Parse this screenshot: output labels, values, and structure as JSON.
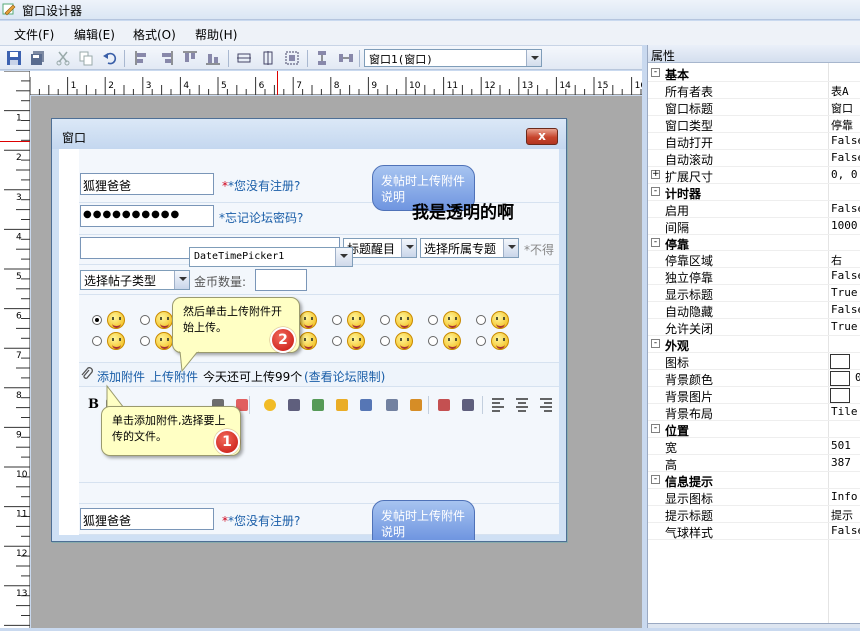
{
  "window": {
    "title": "窗口设计器"
  },
  "menu": [
    "文件(F)",
    "编辑(E)",
    "格式(O)",
    "帮助(H)"
  ],
  "toolbar": {
    "form_selector": "窗口1(窗口)"
  },
  "ruler": {
    "h_labels": [
      "1",
      "2",
      "3",
      "4",
      "5",
      "6",
      "7",
      "8",
      "9",
      "10",
      "11",
      "12",
      "13",
      "14",
      "15",
      "16"
    ],
    "v_labels": [
      "1",
      "2",
      "3",
      "4",
      "5",
      "6",
      "7",
      "8",
      "9",
      "10",
      "11",
      "12",
      "13"
    ]
  },
  "design_window": {
    "title": "窗口",
    "close_label": "x",
    "username_value": "狐狸爸爸",
    "not_registered": "*您没有注册?",
    "password_dots": "●●●●●●●●●●",
    "forgot_password": "*忘记论坛密码?",
    "bubble_text": "发帖时上传附件说明",
    "transparent_text": "我是透明的啊",
    "title_select": "标题醒目",
    "topic_select": "选择所属专题",
    "not_allowed": "*不得",
    "datetime_picker": "DateTimePicker1",
    "post_type": "选择帖子类型",
    "coin_label": "金币数量:",
    "attach_add": "添加附件",
    "attach_upload": "上传附件",
    "attach_info": "今天还可上传99个",
    "attach_limit": "(查看论坛限制)",
    "bold_btn": "B",
    "tip2": "然后单击上传附件开始上传。",
    "tip2_num": "2",
    "tip1": "单击添加附件,选择要上传的文件。",
    "tip1_num": "1",
    "username_value2": "狐狸爸爸",
    "not_registered2": "*您没有注册?",
    "bubble_text2": "发帖时上传附件说明"
  },
  "properties": {
    "header": "属性",
    "rows": [
      {
        "group": true,
        "key": "基本",
        "pm": "-"
      },
      {
        "key": "所有者表",
        "value": "表A"
      },
      {
        "key": "窗口标题",
        "value": "窗口"
      },
      {
        "key": "窗口类型",
        "value": "停靠"
      },
      {
        "key": "自动打开",
        "value": "False"
      },
      {
        "key": "自动滚动",
        "value": "False"
      },
      {
        "key": "扩展尺寸",
        "value": "0, 0",
        "pm": "+"
      },
      {
        "group": true,
        "key": "计时器",
        "pm": "-"
      },
      {
        "key": "启用",
        "value": "False"
      },
      {
        "key": "间隔",
        "value": "1000"
      },
      {
        "group": true,
        "key": "停靠",
        "pm": "-"
      },
      {
        "key": "停靠区域",
        "value": "右"
      },
      {
        "key": "独立停靠",
        "value": "False"
      },
      {
        "key": "显示标题",
        "value": "True"
      },
      {
        "key": "自动隐藏",
        "value": "False"
      },
      {
        "key": "允许关闭",
        "value": "True"
      },
      {
        "group": true,
        "key": "外观",
        "pm": "-"
      },
      {
        "key": "图标",
        "value": "",
        "box": true
      },
      {
        "key": "背景颜色",
        "value": "0",
        "box": true
      },
      {
        "key": "背景图片",
        "value": "",
        "box": true
      },
      {
        "key": "背景布局",
        "value": "Tile"
      },
      {
        "group": true,
        "key": "位置",
        "pm": "-"
      },
      {
        "key": "宽",
        "value": "501"
      },
      {
        "key": "高",
        "value": "387"
      },
      {
        "group": true,
        "key": "信息提示",
        "pm": "-"
      },
      {
        "key": "显示图标",
        "value": "Info"
      },
      {
        "key": "提示标题",
        "value": "提示"
      },
      {
        "key": "气球样式",
        "value": "False"
      }
    ]
  }
}
